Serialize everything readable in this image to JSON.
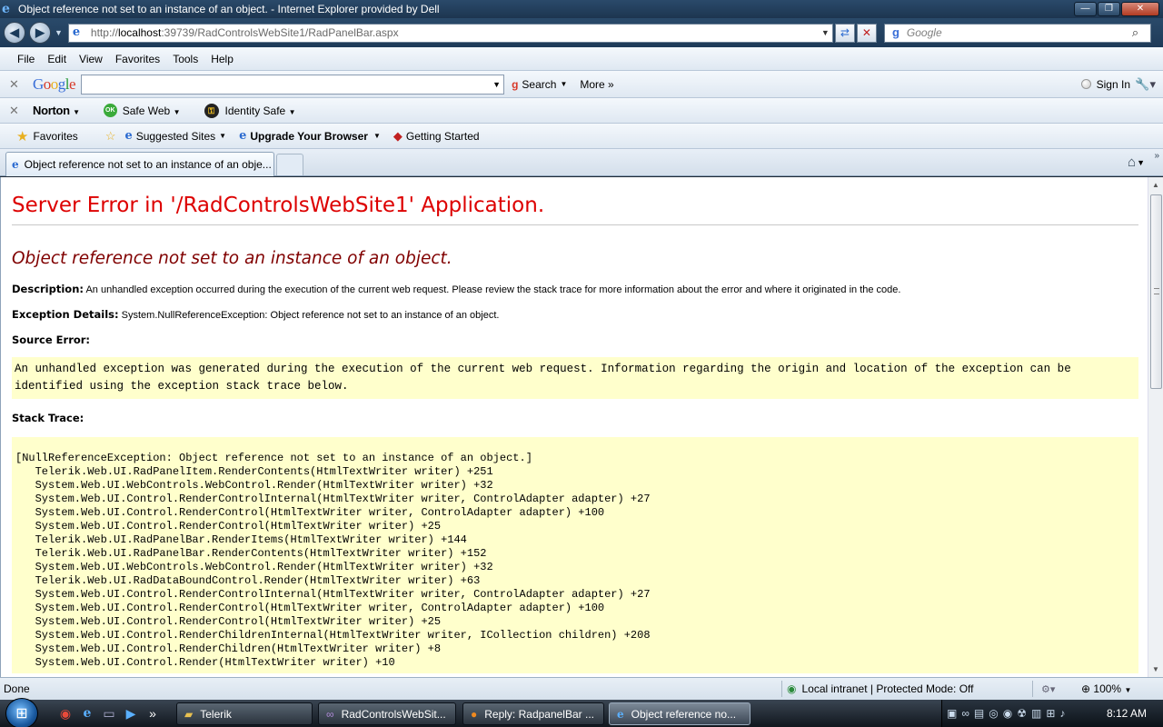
{
  "window": {
    "title": "Object reference not set to an instance of an object. - Internet Explorer provided by Dell",
    "min": "—",
    "max": "❐",
    "close": "✕"
  },
  "address": {
    "url_prefix": "http://",
    "url_host": "localhost",
    "url_rest": ":39739/RadControlsWebSite1/RadPanelBar.aspx",
    "search_placeholder": "Google"
  },
  "menu": [
    "File",
    "Edit",
    "View",
    "Favorites",
    "Tools",
    "Help"
  ],
  "google_toolbar": {
    "search_label": "Search",
    "more_label": "More",
    "signin_label": "Sign In"
  },
  "norton_toolbar": {
    "brand": "Norton",
    "safe_web": "Safe Web",
    "identity_safe": "Identity Safe",
    "ok_badge": "OK"
  },
  "favorites_bar": {
    "favorites": "Favorites",
    "suggested": "Suggested Sites",
    "upgrade": "Upgrade Your Browser",
    "getting_started": "Getting Started"
  },
  "tab": {
    "title": "Object reference not set to an instance of an obje..."
  },
  "page": {
    "heading": "Server Error in '/RadControlsWebSite1' Application.",
    "subheading": "Object reference not set to an instance of an object.",
    "description_label": "Description:",
    "description_text": "An unhandled exception occurred during the execution of the current web request. Please review the stack trace for more information about the error and where it originated in the code.",
    "exception_label": "Exception Details:",
    "exception_text": "System.NullReferenceException: Object reference not set to an instance of an object.",
    "source_error_label": "Source Error:",
    "source_error_text": "An unhandled exception was generated during the execution of the current web request. Information regarding the origin and location of the exception can be identified using the exception stack trace below.",
    "stack_trace_label": "Stack Trace:",
    "stack_trace": "[NullReferenceException: Object reference not set to an instance of an object.]\n   Telerik.Web.UI.RadPanelItem.RenderContents(HtmlTextWriter writer) +251\n   System.Web.UI.WebControls.WebControl.Render(HtmlTextWriter writer) +32\n   System.Web.UI.Control.RenderControlInternal(HtmlTextWriter writer, ControlAdapter adapter) +27\n   System.Web.UI.Control.RenderControl(HtmlTextWriter writer, ControlAdapter adapter) +100\n   System.Web.UI.Control.RenderControl(HtmlTextWriter writer) +25\n   Telerik.Web.UI.RadPanelBar.RenderItems(HtmlTextWriter writer) +144\n   Telerik.Web.UI.RadPanelBar.RenderContents(HtmlTextWriter writer) +152\n   System.Web.UI.WebControls.WebControl.Render(HtmlTextWriter writer) +32\n   Telerik.Web.UI.RadDataBoundControl.Render(HtmlTextWriter writer) +63\n   System.Web.UI.Control.RenderControlInternal(HtmlTextWriter writer, ControlAdapter adapter) +27\n   System.Web.UI.Control.RenderControl(HtmlTextWriter writer, ControlAdapter adapter) +100\n   System.Web.UI.Control.RenderControl(HtmlTextWriter writer) +25\n   System.Web.UI.Control.RenderChildrenInternal(HtmlTextWriter writer, ICollection children) +208\n   System.Web.UI.Control.RenderChildren(HtmlTextWriter writer) +8\n   System.Web.UI.Control.Render(HtmlTextWriter writer) +10"
  },
  "status": {
    "text": "Done",
    "zone": "Local intranet | Protected Mode: Off",
    "zoom": "100%"
  },
  "taskbar": {
    "buttons": [
      "Telerik",
      "RadControlsWebSit...",
      "Reply: RadpanelBar ...",
      "Object reference no..."
    ],
    "clock": "8:12 AM"
  }
}
